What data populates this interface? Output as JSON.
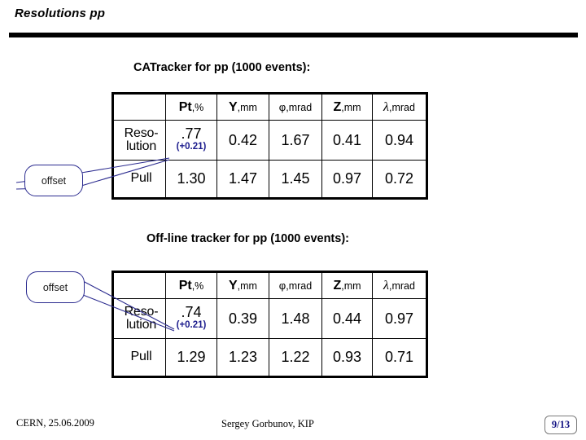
{
  "slide": {
    "title": "Resolutions pp"
  },
  "section_catracker": {
    "caption": "CATracker for pp (1000 events):",
    "table": {
      "headers": [
        {
          "main": "Pt",
          "unit": ",%",
          "style": "bold"
        },
        {
          "main": "Y",
          "unit": ",mm",
          "style": "bold"
        },
        {
          "main": "φ",
          "unit": ",mrad",
          "style": "small"
        },
        {
          "main": "Z",
          "unit": ",mm",
          "style": "bold"
        },
        {
          "main": "λ",
          "unit": ",mrad",
          "style": "symbol"
        }
      ],
      "rows": [
        {
          "label_line1": "Reso-",
          "label_line2": "lution",
          "pt_value": ".77",
          "pt_offset": "(+0.21)",
          "values": [
            "0.42",
            "1.67",
            "0.41",
            "0.94"
          ]
        },
        {
          "label_line1": "Pull",
          "label_line2": "",
          "pt_value": "1.30",
          "pt_offset": "",
          "values": [
            "1.47",
            "1.45",
            "0.97",
            "0.72"
          ]
        }
      ]
    },
    "callout": {
      "label": "offset"
    }
  },
  "section_offline": {
    "caption": "Off-line tracker for pp (1000 events):",
    "table": {
      "headers": [
        {
          "main": "Pt",
          "unit": ",%",
          "style": "bold"
        },
        {
          "main": "Y",
          "unit": ",mm",
          "style": "bold"
        },
        {
          "main": "φ",
          "unit": ",mrad",
          "style": "small"
        },
        {
          "main": "Z",
          "unit": ",mm",
          "style": "bold"
        },
        {
          "main": "λ",
          "unit": ",mrad",
          "style": "symbol"
        }
      ],
      "rows": [
        {
          "label_line1": "Reso-",
          "label_line2": "lution",
          "pt_value": ".74",
          "pt_offset": "(+0.21)",
          "values": [
            "0.39",
            "1.48",
            "0.44",
            "0.97"
          ]
        },
        {
          "label_line1": "Pull",
          "label_line2": "",
          "pt_value": "1.29",
          "pt_offset": "",
          "values": [
            "1.23",
            "1.22",
            "0.93",
            "0.71"
          ]
        }
      ]
    },
    "callout": {
      "label": "offset"
    }
  },
  "footer": {
    "date": "CERN, 25.06.2009",
    "author": "Sergey Gorbunov, KIP",
    "page": "9/13"
  },
  "colors": {
    "offset_blue": "#1a1a8c",
    "callout_border": "#2b2b8f",
    "page_number": "#131384",
    "rule": "#000000"
  }
}
